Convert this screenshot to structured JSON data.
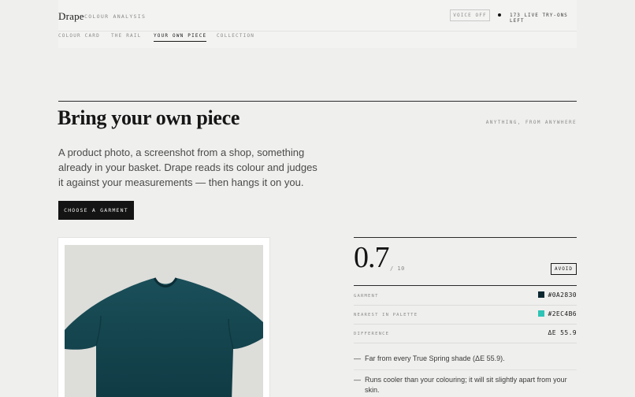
{
  "header": {
    "brand": "Drape",
    "brand_sub": "COLOUR ANALYSIS",
    "voice_label": "VOICE OFF",
    "live_text": "173 LIVE TRY-ONS LEFT"
  },
  "nav": {
    "items": [
      {
        "label": "COLOUR CARD"
      },
      {
        "label": "THE RAIL"
      },
      {
        "label": "YOUR OWN PIECE"
      },
      {
        "label": "COLLECTION"
      }
    ],
    "active": "YOUR OWN PIECE"
  },
  "section": {
    "title": "Bring your own piece",
    "tag": "ANYTHING, FROM ANYWHERE",
    "lede": "A product photo, a screenshot from a shop, something already in your basket. Drape reads its colour and judges it against your measurements — then hangs it on you.",
    "cta_label": "CHOOSE A GARMENT"
  },
  "result": {
    "score": "0.7",
    "score_den": "/ 10",
    "verdict": "AVOID",
    "rows": [
      {
        "label": "GARMENT",
        "value": "#0A2830",
        "swatch": "#0A2830"
      },
      {
        "label": "NEAREST IN PALETTE",
        "value": "#2EC4B6",
        "swatch": "#2EC4B6"
      },
      {
        "label": "DIFFERENCE",
        "value": "ΔE 55.9"
      }
    ],
    "notes": [
      "Far from every True Spring shade (ΔE 55.9).",
      "Runs cooler than your colouring; it will sit slightly apart from your skin."
    ]
  },
  "photo": {
    "garment_color": "#123f48",
    "icon": "t-shirt-photo"
  }
}
